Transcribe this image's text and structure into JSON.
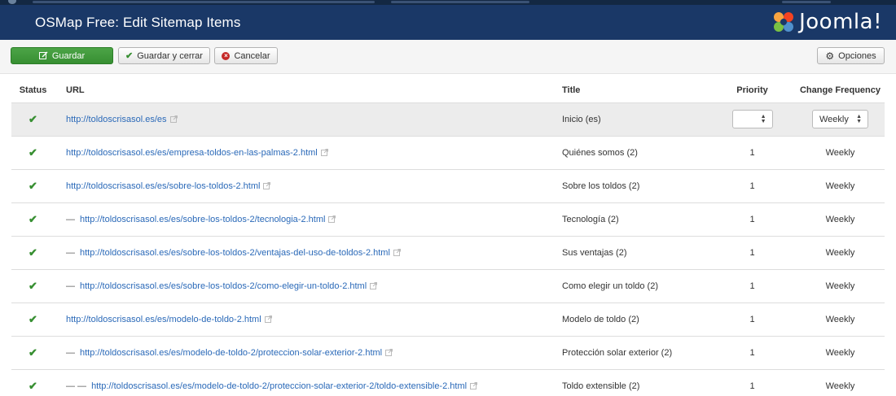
{
  "header": {
    "title": "OSMap Free: Edit Sitemap Items",
    "brand": "Joomla!"
  },
  "toolbar": {
    "save": "Guardar",
    "save_close": "Guardar y cerrar",
    "cancel": "Cancelar",
    "options": "Opciones"
  },
  "table": {
    "headers": {
      "status": "Status",
      "url": "URL",
      "title": "Title",
      "priority": "Priority",
      "frequency": "Change Frequency"
    },
    "rows": [
      {
        "dash": "",
        "url": "http://toldoscrisasol.es/es",
        "title": "Inicio (es)",
        "priority": "",
        "frequency": "Weekly"
      },
      {
        "dash": "",
        "url": "http://toldoscrisasol.es/es/empresa-toldos-en-las-palmas-2.html",
        "title": "Quiénes somos (2)",
        "priority": "1",
        "frequency": "Weekly"
      },
      {
        "dash": "",
        "url": "http://toldoscrisasol.es/es/sobre-los-toldos-2.html",
        "title": "Sobre los toldos (2)",
        "priority": "1",
        "frequency": "Weekly"
      },
      {
        "dash": "—",
        "url": "http://toldoscrisasol.es/es/sobre-los-toldos-2/tecnologia-2.html",
        "title": "Tecnología (2)",
        "priority": "1",
        "frequency": "Weekly"
      },
      {
        "dash": "—",
        "url": "http://toldoscrisasol.es/es/sobre-los-toldos-2/ventajas-del-uso-de-toldos-2.html",
        "title": "Sus ventajas (2)",
        "priority": "1",
        "frequency": "Weekly"
      },
      {
        "dash": "—",
        "url": "http://toldoscrisasol.es/es/sobre-los-toldos-2/como-elegir-un-toldo-2.html",
        "title": "Como elegir un toldo (2)",
        "priority": "1",
        "frequency": "Weekly"
      },
      {
        "dash": "",
        "url": "http://toldoscrisasol.es/es/modelo-de-toldo-2.html",
        "title": "Modelo de toldo (2)",
        "priority": "1",
        "frequency": "Weekly"
      },
      {
        "dash": "—",
        "url": "http://toldoscrisasol.es/es/modelo-de-toldo-2/proteccion-solar-exterior-2.html",
        "title": "Protección solar exterior (2)",
        "priority": "1",
        "frequency": "Weekly"
      },
      {
        "dash": "— —",
        "url": "http://toldoscrisasol.es/es/modelo-de-toldo-2/proteccion-solar-exterior-2/toldo-extensible-2.html",
        "title": "Toldo extensible (2)",
        "priority": "1",
        "frequency": "Weekly"
      }
    ]
  },
  "icons": {
    "status": "check-icon",
    "external": "external-link-icon",
    "options": "gear-icon",
    "cancel": "cancel-circle-icon",
    "save": "edit-icon"
  },
  "colors": {
    "header": "#1a3867",
    "save_button": "#3f9a3a",
    "link": "#2a69b8",
    "check": "#378f32",
    "cancel_icon": "#c52827"
  }
}
